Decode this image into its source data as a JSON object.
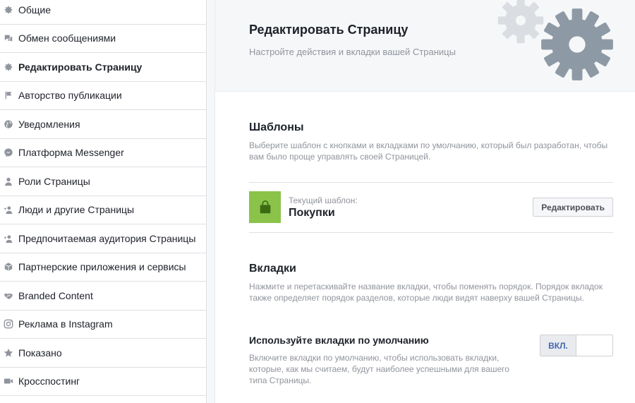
{
  "sidebar": {
    "items": [
      {
        "label": "Общие",
        "icon": "gear-icon",
        "active": false
      },
      {
        "label": "Обмен сообщениями",
        "icon": "chat-icon",
        "active": false
      },
      {
        "label": "Редактировать Страницу",
        "icon": "gear-icon",
        "active": true
      },
      {
        "label": "Авторство публикации",
        "icon": "flag-icon",
        "active": false
      },
      {
        "label": "Уведомления",
        "icon": "globe-icon",
        "active": false
      },
      {
        "label": "Платформа Messenger",
        "icon": "messenger-icon",
        "active": false
      },
      {
        "label": "Роли Страницы",
        "icon": "person-icon",
        "active": false
      },
      {
        "label": "Люди и другие Страницы",
        "icon": "person-add-icon",
        "active": false
      },
      {
        "label": "Предпочитаемая аудитория Страницы",
        "icon": "person-add-icon",
        "active": false
      },
      {
        "label": "Партнерские приложения и сервисы",
        "icon": "box-icon",
        "active": false
      },
      {
        "label": "Branded Content",
        "icon": "handshake-icon",
        "active": false
      },
      {
        "label": "Реклама в Instagram",
        "icon": "instagram-icon",
        "active": false
      },
      {
        "label": "Показано",
        "icon": "star-icon",
        "active": false
      },
      {
        "label": "Кросспостинг",
        "icon": "video-icon",
        "active": false
      }
    ]
  },
  "header": {
    "title": "Редактировать Страницу",
    "subtitle": "Настройте действия и вкладки вашей Страницы",
    "gear_light_color": "#dadde1",
    "gear_dark_color": "#8d9aa5"
  },
  "templates": {
    "title": "Шаблоны",
    "description": "Выберите шаблон с кнопками и вкладками по умолчанию, который был разработан, чтобы вам было проще управлять своей Страницей.",
    "current_caption": "Текущий шаблон:",
    "current_name": "Покупки",
    "thumb_icon": "shopping-bag-icon",
    "thumb_color": "#8bc34a",
    "edit_label": "Редактировать"
  },
  "tabs": {
    "title": "Вкладки",
    "description": "Нажмите и перетаскивайте название вкладки, чтобы поменять порядок. Порядок вкладок также определяет порядок разделов, которые люди видят наверху вашей Страницы."
  },
  "default_tabs": {
    "title": "Используйте вкладки по умолчанию",
    "description": "Включите вкладки по умолчанию, чтобы использовать вкладки, которые, как мы считаем, будут наиболее успешными для вашего типа Страницы.",
    "toggle_on_label": "ВКЛ.",
    "toggle_state": "on",
    "accent_color": "#4267b2"
  }
}
